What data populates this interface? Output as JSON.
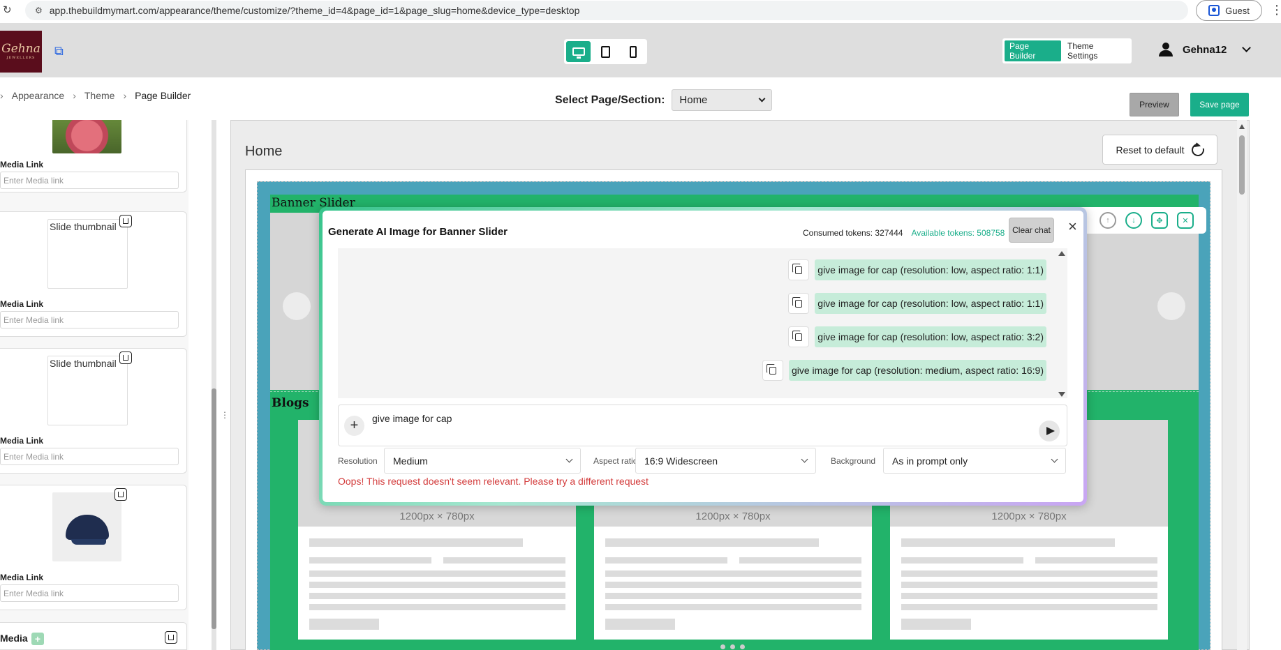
{
  "browser": {
    "url": "app.thebuildmymart.com/appearance/theme/customize/?theme_id=4&page_id=1&page_slug=home&device_type=desktop",
    "guest_label": "Guest"
  },
  "header": {
    "logo_text": "Gehna",
    "logo_sub": "JEWELLERS",
    "mode_tabs": [
      "Page Builder",
      "Theme Settings"
    ],
    "active_mode": "Page Builder",
    "username": "Gehna12",
    "accent_color": "#1aae8a"
  },
  "breadcrumb": [
    "Appearance",
    "Theme",
    "Page Builder"
  ],
  "page_select": {
    "label": "Select Page/Section:",
    "value": "Home"
  },
  "actions": {
    "preview": "Preview",
    "save": "Save page"
  },
  "sidebar": {
    "media_link_label": "Media Link",
    "media_link_placeholder": "Enter Media link",
    "thumb_alt": "Slide thumbnail",
    "footer_label": "Media"
  },
  "canvas": {
    "title": "Home",
    "reset_label": "Reset to default",
    "banner_label": "Banner Slider",
    "blogs_label": "Blogs",
    "blog_image_placeholder": "1200px × 780px"
  },
  "modal": {
    "title": "Generate AI Image for Banner Slider",
    "consumed_tokens": "Consumed tokens: 327444",
    "available_tokens": "Available tokens: 508758",
    "clear_chat": "Clear chat",
    "messages": [
      "give image for cap (resolution: low, aspect ratio: 1:1)",
      "give image for cap (resolution: low, aspect ratio: 1:1)",
      "give image for cap (resolution: low, aspect ratio: 3:2)",
      "give image for cap (resolution: medium, aspect ratio: 16:9)"
    ],
    "prompt_value": "give image for cap",
    "resolution_label": "Resolution",
    "resolution_value": "Medium",
    "aspect_label": "Aspect ratio",
    "aspect_value": "16:9 Widescreen",
    "background_label": "Background",
    "background_value": "As in prompt only",
    "error_text": "Oops! This request doesn't seem relevant. Please try a different request",
    "error_color": "#d33b3b"
  }
}
